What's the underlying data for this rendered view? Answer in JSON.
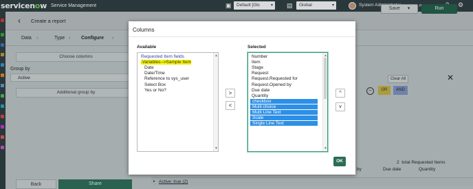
{
  "topbar": {
    "logo_pre": "servicen",
    "logo_o": "o",
    "logo_post": "w",
    "product": "Service Management",
    "update_set": "Default [Glc",
    "scope": "Global",
    "user": "System Administrator"
  },
  "page": {
    "title": "Create a report",
    "steps": [
      "Data",
      "Type",
      "Configure"
    ],
    "save_label": "Save",
    "run_label": "Run",
    "choose_columns": "Choose columns",
    "group_by_label": "Group by",
    "group_by_value": "Active",
    "additional_group_by": "Additional group by",
    "back_label": "Back",
    "share_label": "Share",
    "clear_all": "Clear All",
    "or_label": "OR",
    "and_label": "AND",
    "results_count": "2",
    "results_text": "total Requested Items",
    "col_headers": [
      "ed by",
      "Due date",
      "Quantity"
    ],
    "active_row": "Active: true (2)"
  },
  "modal": {
    "title": "Columns",
    "available_label": "Available",
    "selected_label": "Selected",
    "available_items": [
      {
        "label": "Requested Item fields",
        "style": "blue"
      },
      {
        "label": ".Variables-->Sample Item",
        "style": "hl"
      },
      {
        "label": "Date",
        "style": "indent"
      },
      {
        "label": "Date/Time",
        "style": "indent"
      },
      {
        "label": "Reference to sys_user",
        "style": "indent"
      },
      {
        "label": "Select Box",
        "style": "indent"
      },
      {
        "label": "Yes or No?",
        "style": "indent"
      }
    ],
    "selected_items": [
      {
        "label": "Number",
        "picked": false
      },
      {
        "label": "Item",
        "picked": false
      },
      {
        "label": "Stage",
        "picked": false
      },
      {
        "label": "Request",
        "picked": false
      },
      {
        "label": "Request.Requested for",
        "picked": false
      },
      {
        "label": "Request.Opened by",
        "picked": false
      },
      {
        "label": "Due date",
        "picked": false
      },
      {
        "label": "Quantity",
        "picked": false
      },
      {
        "label": "checkbox",
        "picked": true
      },
      {
        "label": "Multi choice",
        "picked": true
      },
      {
        "label": "Multi Line Text",
        "picked": true
      },
      {
        "label": "Scale",
        "picked": true
      },
      {
        "label": "Single Line Text",
        "picked": true
      }
    ],
    "add_symbol": ">",
    "remove_symbol": "<",
    "up_symbol": "^",
    "down_symbol": "v",
    "ok_label": "OK"
  }
}
